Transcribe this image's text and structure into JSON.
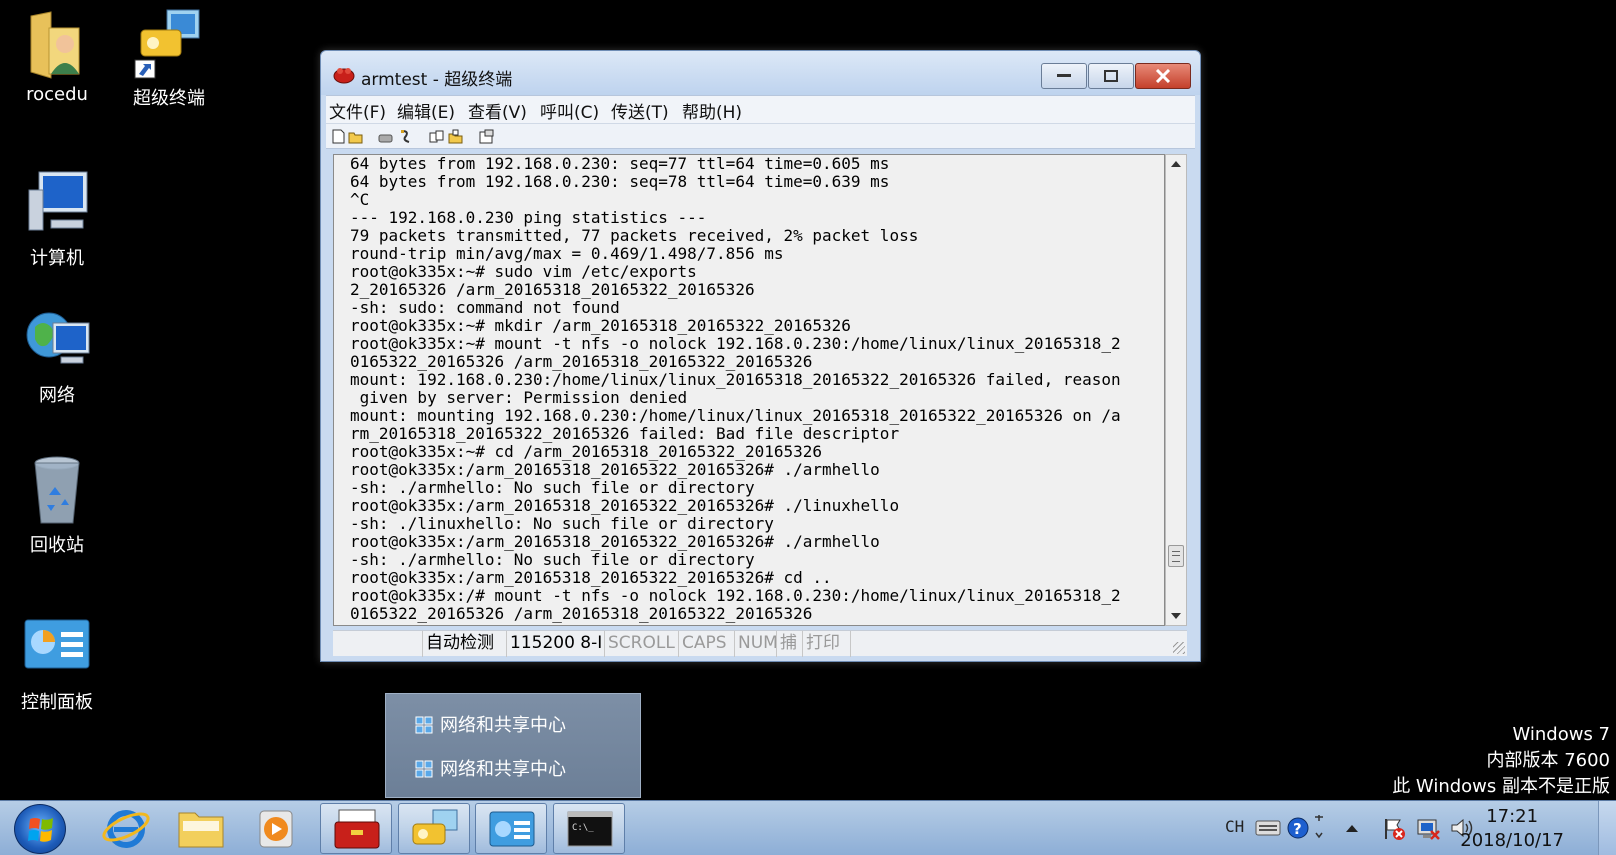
{
  "desktop_icons": [
    {
      "label": "rocedu",
      "icon": "user-folder-icon"
    },
    {
      "label": "超级终端",
      "icon": "hyperterminal-shortcut-icon"
    },
    {
      "label": "计算机",
      "icon": "computer-icon"
    },
    {
      "label": "网络",
      "icon": "network-icon"
    },
    {
      "label": "回收站",
      "icon": "recycle-bin-icon"
    },
    {
      "label": "控制面板",
      "icon": "control-panel-icon"
    }
  ],
  "window": {
    "title": "armtest - 超级终端",
    "menu": [
      "文件(F)",
      "编辑(E)",
      "查看(V)",
      "呼叫(C)",
      "传送(T)",
      "帮助(H)"
    ],
    "terminal_lines": [
      "64 bytes from 192.168.0.230: seq=77 ttl=64 time=0.605 ms",
      "64 bytes from 192.168.0.230: seq=78 ttl=64 time=0.639 ms",
      "^C",
      "--- 192.168.0.230 ping statistics ---",
      "79 packets transmitted, 77 packets received, 2% packet loss",
      "round-trip min/avg/max = 0.469/1.498/7.856 ms",
      "root@ok335x:~# sudo vim /etc/exports",
      "2_20165326 /arm_20165318_20165322_20165326",
      "-sh: sudo: command not found",
      "root@ok335x:~# mkdir /arm_20165318_20165322_20165326",
      "root@ok335x:~# mount -t nfs -o nolock 192.168.0.230:/home/linux/linux_20165318_2",
      "0165322_20165326 /arm_20165318_20165322_20165326",
      "mount: 192.168.0.230:/home/linux/linux_20165318_20165322_20165326 failed, reason",
      " given by server: Permission denied",
      "mount: mounting 192.168.0.230:/home/linux/linux_20165318_20165322_20165326 on /a",
      "rm_20165318_20165322_20165326 failed: Bad file descriptor",
      "root@ok335x:~# cd /arm_20165318_20165322_20165326",
      "root@ok335x:/arm_20165318_20165322_20165326# ./armhello",
      "-sh: ./armhello: No such file or directory",
      "root@ok335x:/arm_20165318_20165322_20165326# ./linuxhello",
      "-sh: ./linuxhello: No such file or directory",
      "root@ok335x:/arm_20165318_20165322_20165326# ./armhello",
      "-sh: ./armhello: No such file or directory",
      "root@ok335x:/arm_20165318_20165322_20165326# cd ..",
      "root@ok335x:/# mount -t nfs -o nolock 192.168.0.230:/home/linux/linux_20165318_2",
      "0165322_20165326 /arm_20165318_20165322_20165326"
    ],
    "status": {
      "detect": "自动检测",
      "baud": "115200 8-I",
      "scroll": "SCROLL",
      "caps": "CAPS",
      "num": "NUM",
      "capture": "捕",
      "print": "打印"
    }
  },
  "popup": {
    "items": [
      "网络和共享中心",
      "网络和共享中心"
    ]
  },
  "watermark": {
    "line1": "Windows 7",
    "line2": "内部版本 7600",
    "line3": "此 Windows 副本不是正版"
  },
  "tray": {
    "lang": "CH",
    "time": "17:21",
    "date": "2018/10/17"
  }
}
